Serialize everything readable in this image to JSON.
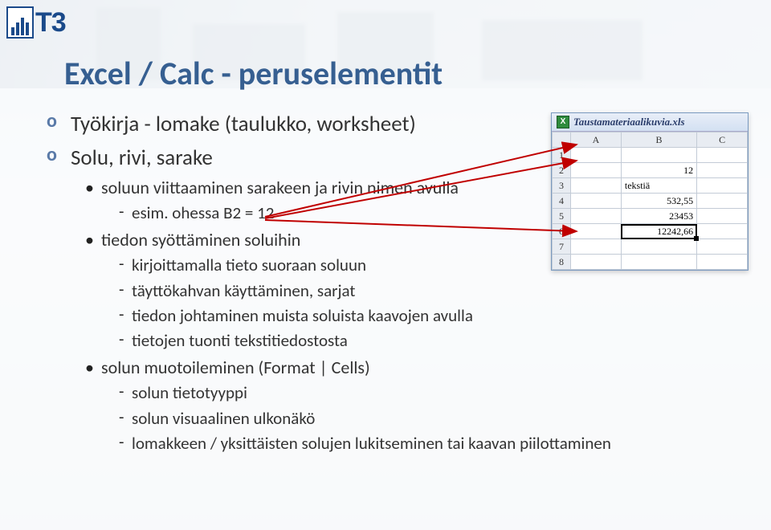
{
  "logo_text": "T3",
  "title": "Excel / Calc - peruselementit",
  "lvl1": [
    {
      "text": "Työkirja - lomake (taulukko, worksheet)"
    },
    {
      "text": "Solu, rivi, sarake"
    }
  ],
  "lvl2": [
    {
      "text": "soluun viittaaminen sarakeen ja rivin nimen avulla",
      "lvl3": [
        {
          "text": "esim. ohessa B2 = 12"
        }
      ]
    },
    {
      "text": "tiedon syöttäminen soluihin",
      "lvl3": [
        {
          "text": "kirjoittamalla tieto suoraan soluun"
        },
        {
          "text": "täyttökahvan käyttäminen, sarjat"
        },
        {
          "text": "tiedon johtaminen muista soluista kaavojen avulla"
        },
        {
          "text": "tietojen tuonti tekstitiedostosta"
        }
      ]
    },
    {
      "text": "solun muotoileminen (Format | Cells)",
      "lvl3": [
        {
          "text": "solun tietotyyppi"
        },
        {
          "text": "solun visuaalinen ulkonäkö"
        },
        {
          "text": "lomakkeen / yksittäisten solujen lukitseminen  tai kaavan piilottaminen"
        }
      ]
    }
  ],
  "xl": {
    "title": "Taustamateriaalikuvia.xls",
    "cols": [
      "",
      "A",
      "B",
      "C"
    ],
    "rows": [
      {
        "h": "1",
        "a": "",
        "b": "",
        "c": ""
      },
      {
        "h": "2",
        "a": "",
        "b": "12",
        "c": ""
      },
      {
        "h": "3",
        "a": "",
        "b": "tekstiä",
        "c": "",
        "txt": true
      },
      {
        "h": "4",
        "a": "",
        "b": "532,55",
        "c": ""
      },
      {
        "h": "5",
        "a": "",
        "b": "23453",
        "c": ""
      },
      {
        "h": "6",
        "a": "",
        "b": "12242,66",
        "c": "",
        "sel": true
      },
      {
        "h": "7",
        "a": "",
        "b": "",
        "c": ""
      },
      {
        "h": "8",
        "a": "",
        "b": "",
        "c": ""
      }
    ]
  }
}
